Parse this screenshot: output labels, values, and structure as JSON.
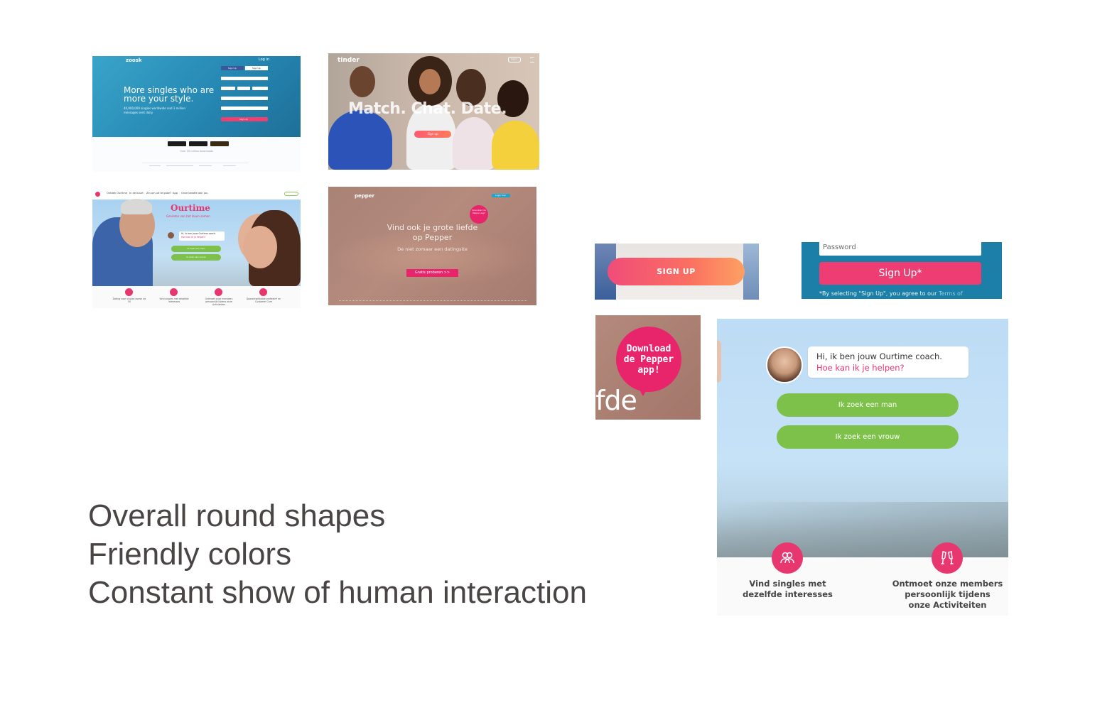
{
  "zoosk": {
    "logo": "zoosk",
    "login": "Log in",
    "tagline": "More singles who are more your style.",
    "sub": "40,000,000 singles worldwide and 3 million messages sent daily.",
    "facebook_label": "Sign Up",
    "google_label": "Sign Up",
    "signup_label": "Sign Up",
    "footer": "Over 30 million downloads"
  },
  "tinder": {
    "logo": "tinder",
    "login": "Log in",
    "headline": "Match. Chat. Date.",
    "cta": "Sign up"
  },
  "ourtime_small": {
    "nav": [
      "Ontdek Ourtime",
      "In de buurt",
      "Zin om uit te gaan?",
      "App",
      "Onze belofte aan jou"
    ],
    "logo": "Ourtime",
    "tagline": "Genieten van het leven samen",
    "chat": "Hi, ik ben jouw Ourtime coach.",
    "chat_q": "Hoe kan ik je helpen?",
    "btn_man": "Ik zoek een man",
    "btn_vrouw": "Ik zoek een vrouw",
    "features": [
      "Dating voor singles boven de 50",
      "Vind singles met dezelfde interesses",
      "Ontmoet onze members persoonlijk tijdens onze Activiteiten",
      "Doorontwikkelde profielen* en Customer Care"
    ]
  },
  "pepper_small": {
    "logo": "pepper",
    "login": "Login hier",
    "badge": "Download de Pepper app!",
    "title_line1": "Vind ook je grote liefde",
    "title_line2": "op Pepper",
    "subtitle": "De niet zomaar een datingsite",
    "cta": "Gratis proberen >>"
  },
  "tinder_zoom": {
    "signup": "SIGN UP"
  },
  "zoosk_zoom": {
    "password_placeholder": "Password",
    "signup": "Sign Up*",
    "legal": "*By selecting \"Sign Up\", you agree to our ",
    "legal_link": "Terms of"
  },
  "pepper_zoom": {
    "bubble_line1": "Download",
    "bubble_line2": "de Pepper",
    "bubble_line3": "app!",
    "fragment": "fde"
  },
  "ourtime_zoom": {
    "chat_line1": "Hi, ik ben jouw Ourtime coach.",
    "chat_line2": "Hoe kan ik je helpen?",
    "btn_man": "Ik zoek een man",
    "btn_vrouw": "Ik zoek een vrouw",
    "feature1_line1": "Vind singles met",
    "feature1_line2": "dezelfde interesses",
    "feature2_line1": "Ontmoet onze members",
    "feature2_line2": "persoonlijk tijdens",
    "feature2_line3": "onze Activiteiten"
  },
  "headline": {
    "line1": "Overall round shapes",
    "line2": "Friendly colors",
    "line3": "Constant show of human interaction"
  },
  "colors": {
    "pink": "#e8366f",
    "green": "#7dc14a",
    "zoosk_blue": "#1c7fa7",
    "text_dark": "#4a4545"
  }
}
